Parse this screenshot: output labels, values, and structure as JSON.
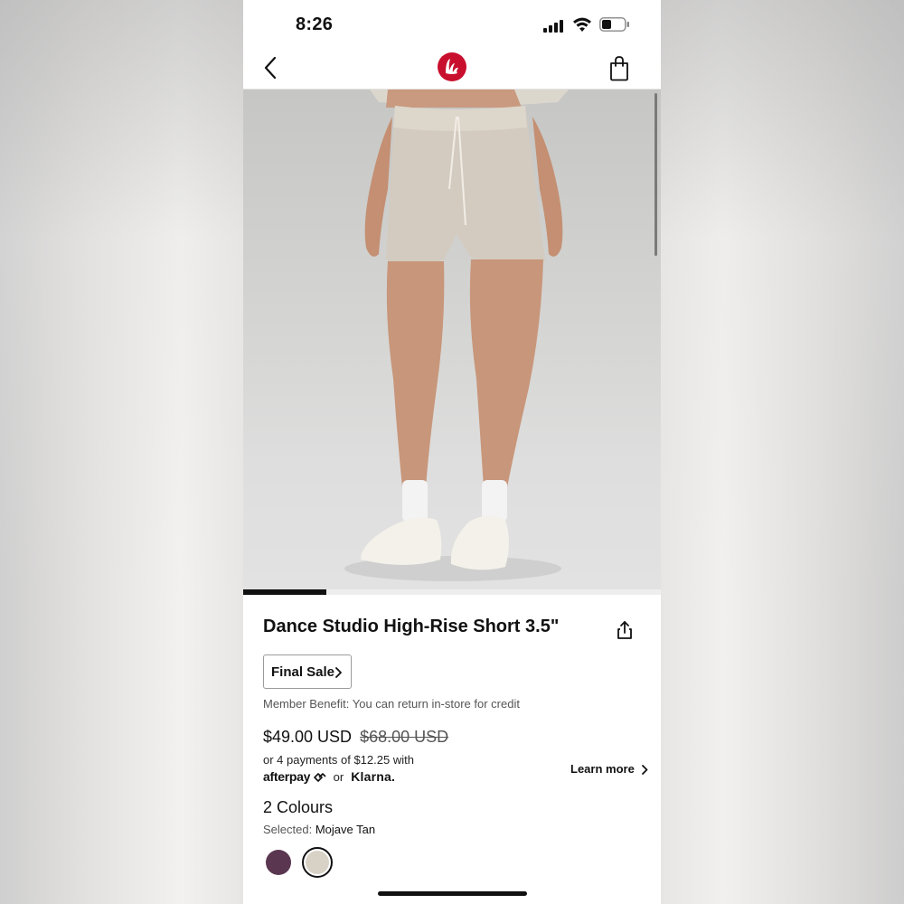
{
  "status_bar": {
    "time": "8:26"
  },
  "nav": {
    "back_icon": "chevron-left-icon",
    "logo_icon": "lululemon-logo-icon",
    "bag_icon": "shopping-bag-icon"
  },
  "carousel": {
    "progress_fraction": 0.2
  },
  "product": {
    "title": "Dance Studio High-Rise Short 3.5\"",
    "share_icon": "share-icon",
    "final_sale_label": "Final Sale",
    "member_benefit": "Member Benefit: You can return in-store for credit",
    "price_now": "$49.00 USD",
    "price_was": "$68.00 USD",
    "payments_text": "or 4 payments of $12.25 with",
    "afterpay_label": "afterpay",
    "or_label": "or",
    "klarna_label": "Klarna.",
    "learn_more_label": "Learn more",
    "colours_title": "2 Colours",
    "selected_label": "Selected:",
    "selected_value": "Mojave Tan",
    "swatches": [
      {
        "color": "#5a3650",
        "selected": false
      },
      {
        "color": "#d8d2c6",
        "selected": true
      }
    ]
  },
  "colors": {
    "brand_red": "#c8102e",
    "text_primary": "#111111",
    "text_secondary": "#555555"
  }
}
